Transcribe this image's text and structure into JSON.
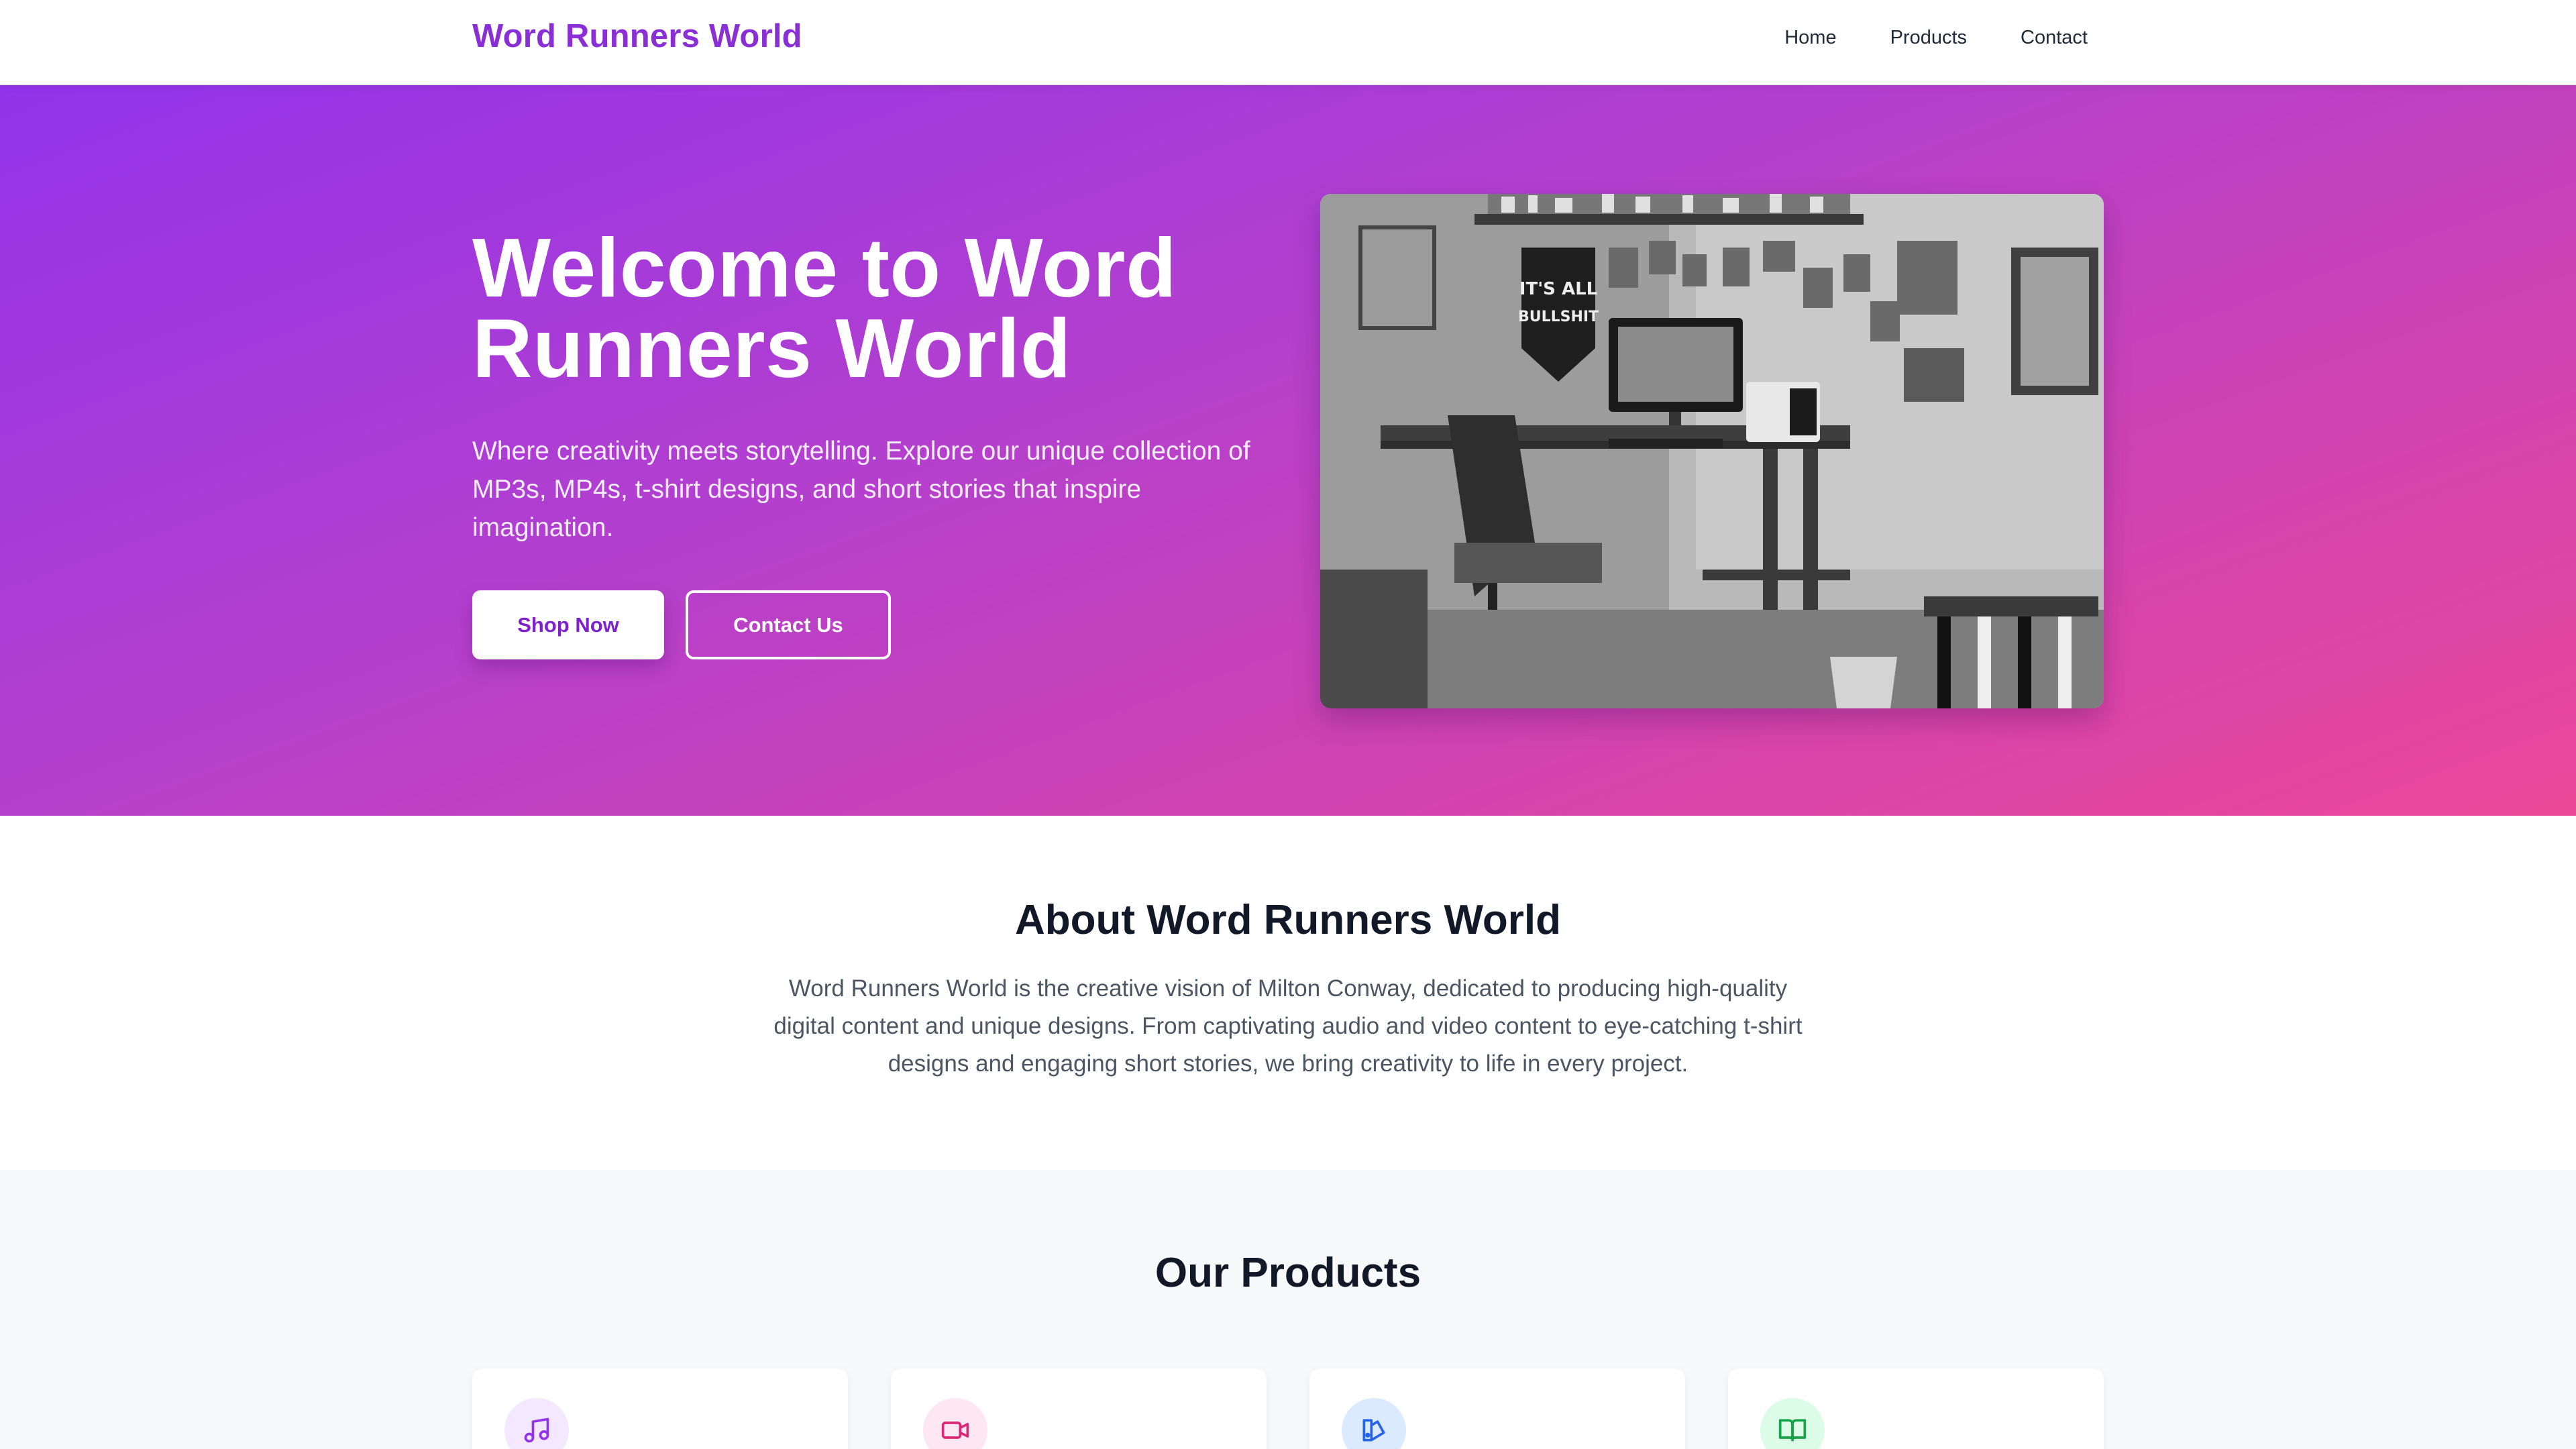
{
  "nav": {
    "brand": "Word Runners World",
    "links": [
      "Home",
      "Products",
      "Contact"
    ]
  },
  "hero": {
    "title": "Welcome to Word Runners World",
    "subtitle": "Where creativity meets storytelling. Explore our unique collection of MP3s, MP4s, t-shirt designs, and short stories that inspire imagination.",
    "shop_label": "Shop Now",
    "contact_label": "Contact Us",
    "image_icon": "desk-workspace-photo",
    "image_pennant_text": "IT'S ALL BULLSHIT"
  },
  "about": {
    "title": "About Word Runners World",
    "text": "Word Runners World is the creative vision of Milton Conway, dedicated to producing high-quality digital content and unique designs. From captivating audio and video content to eye-catching t-shirt designs and engaging short stories, we bring creativity to life in every project."
  },
  "products": {
    "title": "Our Products",
    "cards": [
      {
        "icon": "music-icon",
        "bg": "#f3e8ff",
        "color": "#9333ea"
      },
      {
        "icon": "video-icon",
        "bg": "#fce7f3",
        "color": "#db2777"
      },
      {
        "icon": "design-icon",
        "bg": "#dbeafe",
        "color": "#2563eb"
      },
      {
        "icon": "book-icon",
        "bg": "#dcfce7",
        "color": "#16a34a"
      }
    ]
  },
  "colors": {
    "brand": "#8a2ed6",
    "gradient_start": "#9333ea",
    "gradient_end": "#ec4899"
  }
}
